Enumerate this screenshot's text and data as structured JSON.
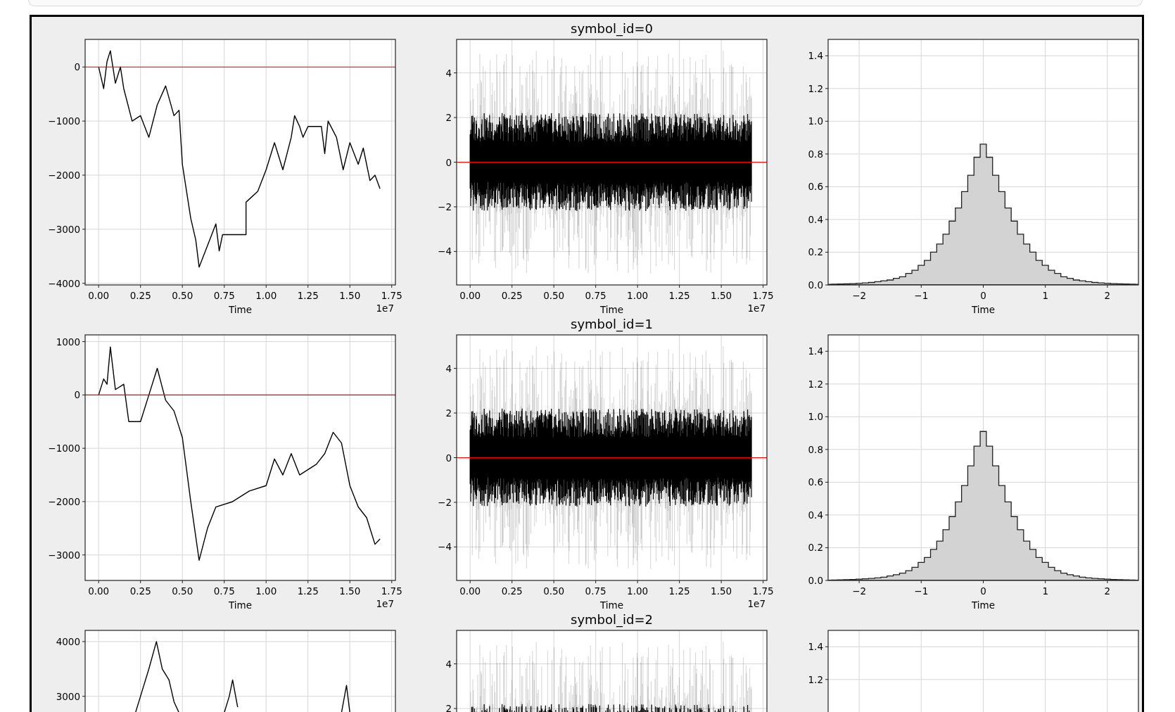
{
  "figure": {
    "rows": [
      {
        "panels": [
          {
            "kind": "line",
            "chart_data": {
              "type": "line",
              "xlabel": "Time",
              "x": [
                0,
                0.03,
                0.05,
                0.07,
                0.1,
                0.13,
                0.15,
                0.2,
                0.25,
                0.3,
                0.35,
                0.4,
                0.45,
                0.48,
                0.5,
                0.52,
                0.55,
                0.58,
                0.6,
                0.65,
                0.7,
                0.72,
                0.74,
                0.88,
                0.88,
                0.95,
                1.0,
                1.05,
                1.1,
                1.15,
                1.17,
                1.2,
                1.22,
                1.25,
                1.33,
                1.35,
                1.37,
                1.42,
                1.46,
                1.5,
                1.55,
                1.58,
                1.62,
                1.65,
                1.68
              ],
              "series": [
                {
                  "color": "#000000",
                  "values": [
                    0,
                    -400,
                    100,
                    300,
                    -300,
                    0,
                    -400,
                    -1000,
                    -900,
                    -1300,
                    -700,
                    -350,
                    -900,
                    -800,
                    -1800,
                    -2200,
                    -2800,
                    -3200,
                    -3700,
                    -3300,
                    -2900,
                    -3400,
                    -3100,
                    -3100,
                    -2500,
                    -2300,
                    -1900,
                    -1400,
                    -1900,
                    -1300,
                    -900,
                    -1100,
                    -1300,
                    -1100,
                    -1100,
                    -1600,
                    -1000,
                    -1300,
                    -1900,
                    -1400,
                    -1800,
                    -1500,
                    -2100,
                    -2000,
                    -2250
                  ]
                }
              ],
              "xlim": [
                -0.0806,
                1.772
              ],
              "ylim": [
                -4030,
                510
              ],
              "xticks": [
                {
                  "value": 0,
                  "label": "0.00"
                },
                {
                  "value": 0.25,
                  "label": "0.25"
                },
                {
                  "value": 0.5,
                  "label": "0.50"
                },
                {
                  "value": 0.75,
                  "label": "0.75"
                },
                {
                  "value": 1.0,
                  "label": "1.00"
                },
                {
                  "value": 1.25,
                  "label": "1.25"
                },
                {
                  "value": 1.5,
                  "label": "1.50"
                },
                {
                  "value": 1.75,
                  "label": "1.75"
                }
              ],
              "yticks": [
                {
                  "value": 0,
                  "label": "0"
                },
                {
                  "value": -1000,
                  "label": "−1000"
                },
                {
                  "value": -2000,
                  "label": "−2000"
                },
                {
                  "value": -3000,
                  "label": "−3000"
                },
                {
                  "value": -4000,
                  "label": "−4000"
                }
              ],
              "grid": true,
              "ref_lines": [
                {
                  "axis": "y",
                  "value": 0,
                  "color": "#ff0000"
                }
              ]
            },
            "offset_label": "1e7"
          },
          {
            "kind": "noise",
            "title": "symbol_id=0",
            "xtick_labels": [
              "0.00",
              "0.25",
              "0.50",
              "0.75",
              "1.00",
              "1.25",
              "1.50",
              "1.75"
            ],
            "ytick_labels": [
              "4",
              "2",
              "0",
              "−2",
              "−4"
            ],
            "xlabel": "Time",
            "offset_label": "1e7"
          },
          {
            "kind": "hist",
            "chart_data": {
              "type": "area",
              "xlabel": "Time",
              "x": [
                -2.5,
                -2.4,
                -2.3,
                -2.2,
                -2.1,
                -2.0,
                -1.9,
                -1.8,
                -1.7,
                -1.6,
                -1.5,
                -1.4,
                -1.3,
                -1.2,
                -1.1,
                -1.0,
                -0.9,
                -0.8,
                -0.7,
                -0.6,
                -0.5,
                -0.4,
                -0.3,
                -0.2,
                -0.1,
                0,
                0.1,
                0.2,
                0.3,
                0.4,
                0.5,
                0.6,
                0.7,
                0.8,
                0.9,
                1.0,
                1.1,
                1.2,
                1.3,
                1.4,
                1.5,
                1.6,
                1.7,
                1.8,
                1.9,
                2.0,
                2.1,
                2.2,
                2.3,
                2.4,
                2.5
              ],
              "series": [
                {
                  "color": "#d3d3d3",
                  "values": [
                    0.004,
                    0.005,
                    0.006,
                    0.007,
                    0.008,
                    0.01,
                    0.012,
                    0.015,
                    0.02,
                    0.025,
                    0.03,
                    0.04,
                    0.05,
                    0.07,
                    0.09,
                    0.12,
                    0.15,
                    0.2,
                    0.25,
                    0.31,
                    0.39,
                    0.47,
                    0.57,
                    0.67,
                    0.78,
                    0.86,
                    0.78,
                    0.67,
                    0.57,
                    0.47,
                    0.39,
                    0.31,
                    0.25,
                    0.2,
                    0.15,
                    0.12,
                    0.09,
                    0.07,
                    0.05,
                    0.04,
                    0.03,
                    0.025,
                    0.02,
                    0.015,
                    0.012,
                    0.01,
                    0.008,
                    0.007,
                    0.006,
                    0.005,
                    0.004
                  ]
                }
              ],
              "xlim": [
                -2.5,
                2.5
              ],
              "ylim": [
                0,
                1.5
              ],
              "xticks": [
                {
                  "value": -2,
                  "label": "−2"
                },
                {
                  "value": -1,
                  "label": "−1"
                },
                {
                  "value": 0,
                  "label": "0"
                },
                {
                  "value": 1,
                  "label": "1"
                },
                {
                  "value": 2,
                  "label": "2"
                }
              ],
              "yticks": [
                {
                  "value": 0,
                  "label": "0.0"
                },
                {
                  "value": 0.2,
                  "label": "0.2"
                },
                {
                  "value": 0.4,
                  "label": "0.4"
                },
                {
                  "value": 0.6,
                  "label": "0.6"
                },
                {
                  "value": 0.8,
                  "label": "0.8"
                },
                {
                  "value": 1.0,
                  "label": "1.0"
                },
                {
                  "value": 1.2,
                  "label": "1.2"
                },
                {
                  "value": 1.4,
                  "label": "1.4"
                }
              ],
              "grid": true
            }
          }
        ]
      },
      {
        "panels": [
          {
            "kind": "line",
            "chart_data": {
              "type": "line",
              "xlabel": "Time",
              "x": [
                0,
                0.03,
                0.05,
                0.07,
                0.1,
                0.15,
                0.18,
                0.25,
                0.3,
                0.35,
                0.4,
                0.45,
                0.5,
                0.55,
                0.6,
                0.65,
                0.7,
                0.8,
                0.9,
                1.0,
                1.05,
                1.1,
                1.15,
                1.2,
                1.3,
                1.35,
                1.4,
                1.45,
                1.5,
                1.55,
                1.6,
                1.65,
                1.68
              ],
              "series": [
                {
                  "color": "#000000",
                  "values": [
                    0,
                    300,
                    200,
                    900,
                    100,
                    200,
                    -500,
                    -500,
                    0,
                    500,
                    -100,
                    -300,
                    -800,
                    -2000,
                    -3100,
                    -2500,
                    -2100,
                    -2000,
                    -1800,
                    -1700,
                    -1200,
                    -1500,
                    -1100,
                    -1500,
                    -1300,
                    -1100,
                    -700,
                    -900,
                    -1700,
                    -2100,
                    -2300,
                    -2800,
                    -2700
                  ]
                }
              ],
              "xlim": [
                -0.0806,
                1.772
              ],
              "ylim": [
                -3478,
                1126
              ],
              "xticks": [
                {
                  "value": 0,
                  "label": "0.00"
                },
                {
                  "value": 0.25,
                  "label": "0.25"
                },
                {
                  "value": 0.5,
                  "label": "0.50"
                },
                {
                  "value": 0.75,
                  "label": "0.75"
                },
                {
                  "value": 1.0,
                  "label": "1.00"
                },
                {
                  "value": 1.25,
                  "label": "1.25"
                },
                {
                  "value": 1.5,
                  "label": "1.50"
                },
                {
                  "value": 1.75,
                  "label": "1.75"
                }
              ],
              "yticks": [
                {
                  "value": 1000,
                  "label": "1000"
                },
                {
                  "value": 0,
                  "label": "0"
                },
                {
                  "value": -1000,
                  "label": "−1000"
                },
                {
                  "value": -2000,
                  "label": "−2000"
                },
                {
                  "value": -3000,
                  "label": "−3000"
                }
              ],
              "grid": true,
              "ref_lines": [
                {
                  "axis": "y",
                  "value": 0,
                  "color": "#ff0000"
                }
              ]
            },
            "offset_label": "1e7"
          },
          {
            "kind": "noise",
            "title": "symbol_id=1",
            "xtick_labels": [
              "0.00",
              "0.25",
              "0.50",
              "0.75",
              "1.00",
              "1.25",
              "1.50",
              "1.75"
            ],
            "ytick_labels": [
              "4",
              "2",
              "0",
              "−2",
              "−4"
            ],
            "xlabel": "Time",
            "offset_label": "1e7"
          },
          {
            "kind": "hist",
            "chart_data": {
              "type": "area",
              "xlabel": "Time",
              "x": [
                -2.5,
                -2.4,
                -2.3,
                -2.2,
                -2.1,
                -2.0,
                -1.9,
                -1.8,
                -1.7,
                -1.6,
                -1.5,
                -1.4,
                -1.3,
                -1.2,
                -1.1,
                -1.0,
                -0.9,
                -0.8,
                -0.7,
                -0.6,
                -0.5,
                -0.4,
                -0.3,
                -0.2,
                -0.1,
                0,
                0.1,
                0.2,
                0.3,
                0.4,
                0.5,
                0.6,
                0.7,
                0.8,
                0.9,
                1.0,
                1.1,
                1.2,
                1.3,
                1.4,
                1.5,
                1.6,
                1.7,
                1.8,
                1.9,
                2.0,
                2.1,
                2.2,
                2.3,
                2.4,
                2.5
              ],
              "series": [
                {
                  "color": "#d3d3d3",
                  "values": [
                    0.002,
                    0.003,
                    0.004,
                    0.005,
                    0.006,
                    0.008,
                    0.01,
                    0.012,
                    0.016,
                    0.02,
                    0.027,
                    0.035,
                    0.045,
                    0.06,
                    0.08,
                    0.11,
                    0.14,
                    0.19,
                    0.24,
                    0.31,
                    0.39,
                    0.48,
                    0.58,
                    0.7,
                    0.82,
                    0.91,
                    0.82,
                    0.7,
                    0.58,
                    0.48,
                    0.39,
                    0.31,
                    0.24,
                    0.19,
                    0.14,
                    0.11,
                    0.08,
                    0.06,
                    0.045,
                    0.035,
                    0.027,
                    0.02,
                    0.016,
                    0.012,
                    0.01,
                    0.008,
                    0.006,
                    0.005,
                    0.004,
                    0.003,
                    0.002
                  ]
                }
              ],
              "xlim": [
                -2.5,
                2.5
              ],
              "ylim": [
                0,
                1.5
              ],
              "xticks": [
                {
                  "value": -2,
                  "label": "−2"
                },
                {
                  "value": -1,
                  "label": "−1"
                },
                {
                  "value": 0,
                  "label": "0"
                },
                {
                  "value": 1,
                  "label": "1"
                },
                {
                  "value": 2,
                  "label": "2"
                }
              ],
              "yticks": [
                {
                  "value": 0,
                  "label": "0.0"
                },
                {
                  "value": 0.2,
                  "label": "0.2"
                },
                {
                  "value": 0.4,
                  "label": "0.4"
                },
                {
                  "value": 0.6,
                  "label": "0.6"
                },
                {
                  "value": 0.8,
                  "label": "0.8"
                },
                {
                  "value": 1.0,
                  "label": "1.0"
                },
                {
                  "value": 1.2,
                  "label": "1.2"
                },
                {
                  "value": 1.4,
                  "label": "1.4"
                }
              ],
              "grid": true
            }
          }
        ]
      },
      {
        "panels": [
          {
            "kind": "line",
            "chart_data": {
              "type": "line",
              "x": [
                0.22,
                0.25,
                0.3,
                0.345,
                0.38,
                0.42,
                0.45,
                0.48,
                0.75,
                0.78,
                0.8,
                0.83,
                1.45,
                1.48,
                1.5
              ],
              "series": [
                {
                  "color": "#000000",
                  "values": [
                    2700,
                    3000,
                    3500,
                    4000,
                    3500,
                    3300,
                    2900,
                    2700,
                    null,
                    null,
                    null,
                    null,
                    null,
                    null,
                    null
                  ]
                },
                {
                  "color": "#000000",
                  "values": [
                    null,
                    null,
                    null,
                    null,
                    null,
                    null,
                    null,
                    null,
                    2700,
                    3000,
                    3300,
                    2800,
                    null,
                    null,
                    null
                  ]
                },
                {
                  "color": "#000000",
                  "values": [
                    null,
                    null,
                    null,
                    null,
                    null,
                    null,
                    null,
                    null,
                    null,
                    null,
                    null,
                    null,
                    2700,
                    3200,
                    2700
                  ]
                }
              ],
              "xlim": [
                -0.0806,
                1.772
              ],
              "ylim": [
                -285,
                4205
              ],
              "yticks": [
                {
                  "value": 4000,
                  "label": "4000"
                },
                {
                  "value": 3000,
                  "label": "3000"
                }
              ],
              "grid": true
            }
          },
          {
            "kind": "noise",
            "title": "symbol_id=2",
            "ytick_labels": [
              "4",
              "2"
            ]
          },
          {
            "kind": "hist",
            "chart_data": {
              "type": "area",
              "xlim": [
                -2.5,
                2.5
              ],
              "ylim": [
                0,
                1.5
              ],
              "yticks": [
                {
                  "value": 1.2,
                  "label": "1.2"
                },
                {
                  "value": 1.4,
                  "label": "1.4"
                }
              ],
              "grid": true
            }
          }
        ]
      }
    ]
  }
}
